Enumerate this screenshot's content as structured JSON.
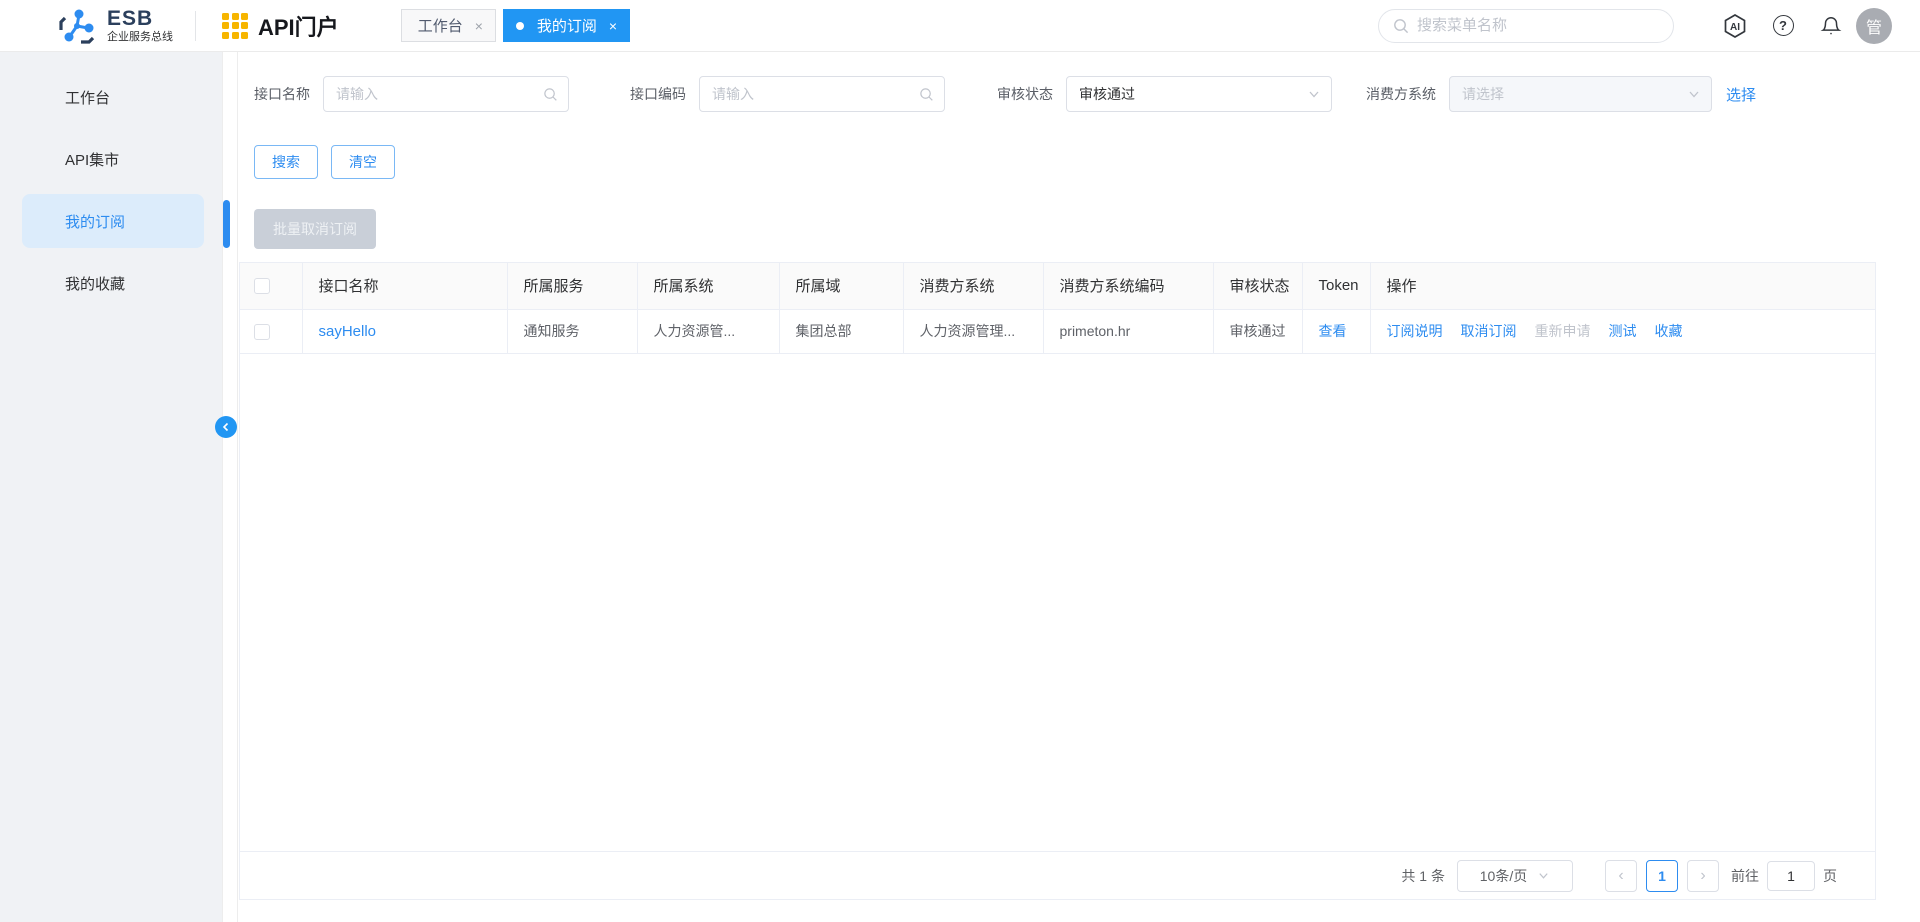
{
  "brand": {
    "esb_title": "ESB",
    "esb_subtitle": "企业服务总线",
    "portal_title": "API门户"
  },
  "topbar": {
    "tabs": [
      {
        "label": "工作台",
        "close": "×",
        "active": false
      },
      {
        "label": "我的订阅",
        "close": "×",
        "active": true
      }
    ],
    "search_placeholder": "搜索菜单名称",
    "ai_icon_text": "AI",
    "avatar_text": "管"
  },
  "sidebar": {
    "items": [
      {
        "label": "工作台",
        "active": false
      },
      {
        "label": "API集市",
        "active": false
      },
      {
        "label": "我的订阅",
        "active": true
      },
      {
        "label": "我的收藏",
        "active": false
      }
    ]
  },
  "filters": {
    "fields": [
      {
        "label": "接口名称",
        "placeholder": "请输入"
      },
      {
        "label": "接口编码",
        "placeholder": "请输入"
      },
      {
        "label": "审核状态",
        "value": "审核通过"
      },
      {
        "label": "消费方系统",
        "placeholder": "请选择",
        "disabled": true
      }
    ],
    "choose_link": "选择",
    "search_button": "搜索",
    "clear_button": "清空"
  },
  "toolbar": {
    "bulk_unsubscribe": "批量取消订阅"
  },
  "table": {
    "columns": [
      "接口名称",
      "所属服务",
      "所属系统",
      "所属域",
      "消费方系统",
      "消费方系统编码",
      "审核状态",
      "Token",
      "操作"
    ],
    "rows": [
      {
        "name": "sayHello",
        "service": "通知服务",
        "system": "人力资源管...",
        "domain": "集团总部",
        "consumer": "人力资源管理...",
        "consumer_code": "primeton.hr",
        "status": "审核通过",
        "token_action": "查看",
        "actions": [
          {
            "label": "订阅说明",
            "disabled": false
          },
          {
            "label": "取消订阅",
            "disabled": false
          },
          {
            "label": "重新申请",
            "disabled": true
          },
          {
            "label": "测试",
            "disabled": false
          },
          {
            "label": "收藏",
            "disabled": false
          }
        ]
      }
    ]
  },
  "pagination": {
    "total": "共 1 条",
    "page_size": "10条/页",
    "prev": "‹",
    "next": "›",
    "current_page": "1",
    "goto_label": "前往",
    "goto_value": "1",
    "page_unit": "页"
  },
  "colors": {
    "primary": "#2196f3",
    "link": "#2d8cf0",
    "sidebar_bg": "#f0f2f5",
    "active_item_bg": "#dcecfb",
    "brand_orange": "#f7b500",
    "table_border": "#ebeef5"
  }
}
